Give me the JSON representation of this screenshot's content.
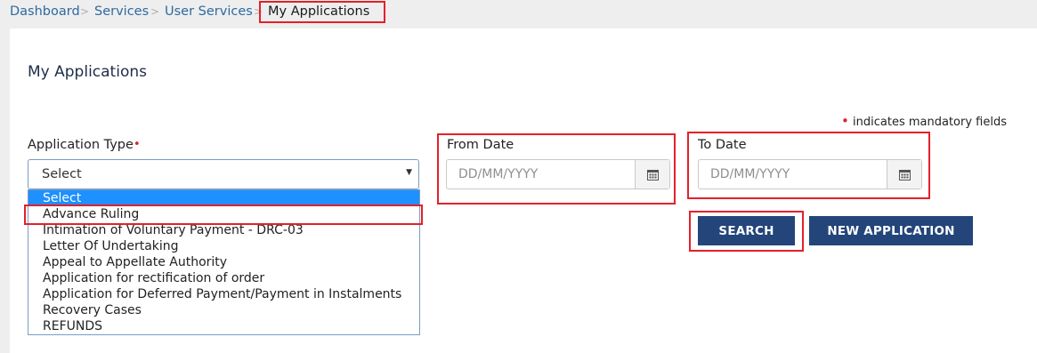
{
  "breadcrumb": {
    "items": [
      "Dashboard",
      "Services",
      "User Services",
      "My Applications"
    ],
    "separator": ">"
  },
  "page_title": "My Applications",
  "mandatory_note": {
    "marker": "•",
    "text": "indicates mandatory fields"
  },
  "form": {
    "application_type": {
      "label": "Application Type",
      "required_marker": "•",
      "selected": "Select",
      "options": [
        "Select",
        "Advance Ruling",
        "Intimation of Voluntary Payment - DRC-03",
        "Letter Of Undertaking",
        "Appeal to Appellate Authority",
        "Application for rectification of order",
        "Application for Deferred Payment/Payment in Instalments",
        "Recovery Cases",
        "REFUNDS"
      ],
      "highlighted_option": "Select",
      "annotated_option": "Advance Ruling"
    },
    "from_date": {
      "label": "From Date",
      "placeholder": "DD/MM/YYYY",
      "icon": "calendar-icon"
    },
    "to_date": {
      "label": "To Date",
      "placeholder": "DD/MM/YYYY",
      "icon": "calendar-icon"
    }
  },
  "buttons": {
    "search": "SEARCH",
    "new_application": "NEW APPLICATION"
  },
  "colors": {
    "link": "#2c6aa0",
    "annotation_red": "#e4202a",
    "required_red": "#d9232d",
    "button_bg": "#23457a",
    "dropdown_highlight": "#1e90ff"
  }
}
